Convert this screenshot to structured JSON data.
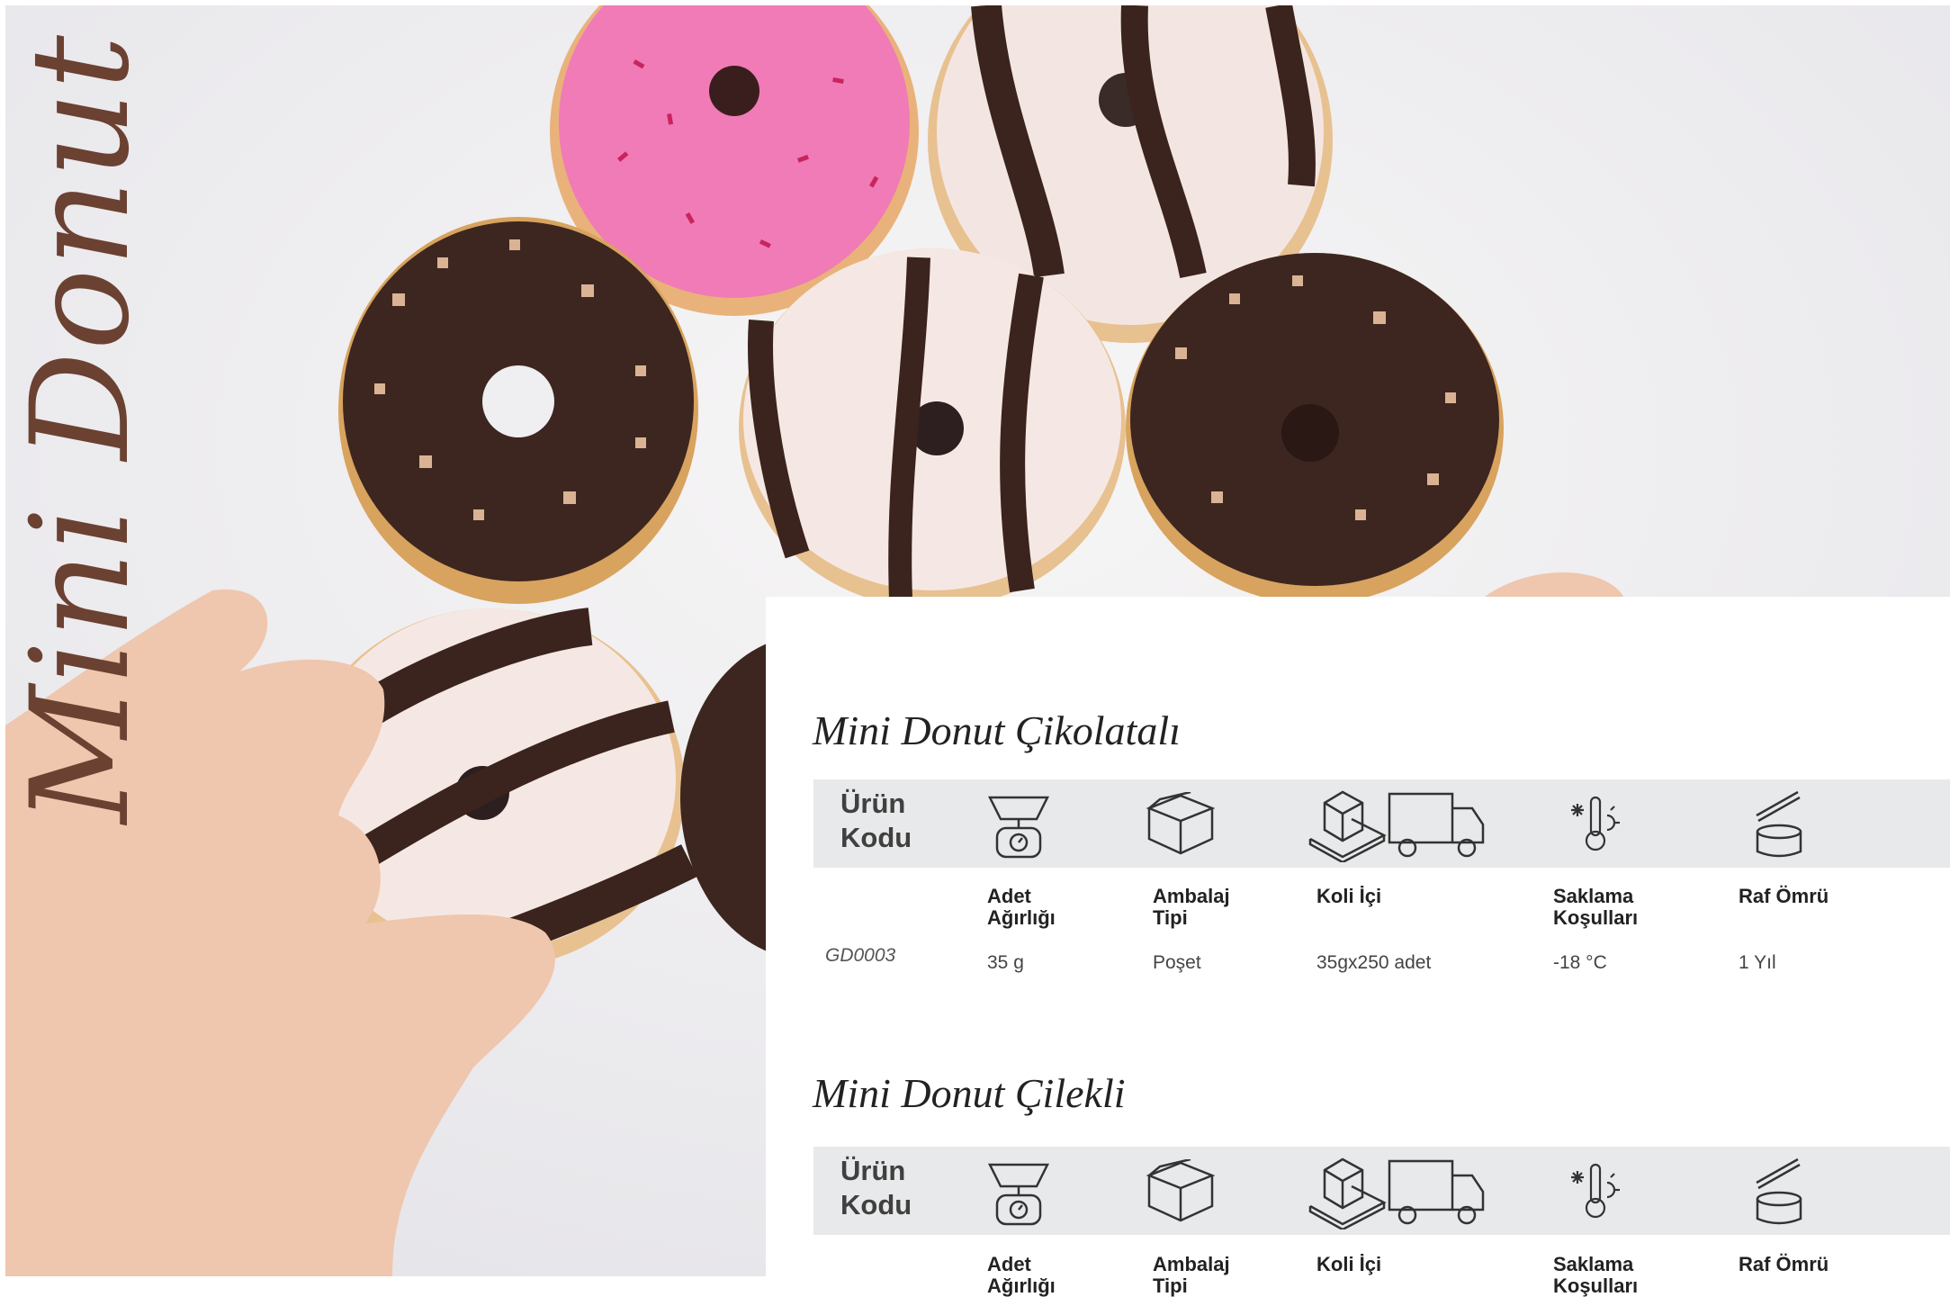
{
  "brand_title": "Mini Donut",
  "colors": {
    "title_brown": "#6b4132",
    "band_grey": "#e8e9ea",
    "chocolate": "#3b241d",
    "pink": "#f07bb6"
  },
  "products": [
    {
      "name": "Mini Donut Çikolatalı",
      "header_label": [
        "Ürün",
        "Kodu"
      ],
      "icons": [
        "scale-icon",
        "box-icon",
        "pallet-truck-icon",
        "thermometer-snowflake-icon",
        "open-can-icon"
      ],
      "columns": [
        [
          "Adet",
          "Ağırlığı"
        ],
        [
          "Ambalaj",
          "Tipi"
        ],
        [
          "Koli İçi",
          ""
        ],
        [
          "Saklama",
          "Koşulları"
        ],
        [
          "Raf Ömrü",
          ""
        ]
      ],
      "row": {
        "code": "GD0003",
        "weight": "35 g",
        "package": "Poşet",
        "case": "35gx250 adet",
        "storage": "-18 °C",
        "shelf": "1 Yıl"
      }
    },
    {
      "name": "Mini Donut Çilekli",
      "header_label": [
        "Ürün",
        "Kodu"
      ],
      "icons": [
        "scale-icon",
        "box-icon",
        "pallet-truck-icon",
        "thermometer-snowflake-icon",
        "open-can-icon"
      ],
      "columns": [
        [
          "Adet",
          "Ağırlığı"
        ],
        [
          "Ambalaj",
          "Tipi"
        ],
        [
          "Koli İçi",
          ""
        ],
        [
          "Saklama",
          "Koşulları"
        ],
        [
          "Raf Ömrü",
          ""
        ]
      ]
    }
  ]
}
